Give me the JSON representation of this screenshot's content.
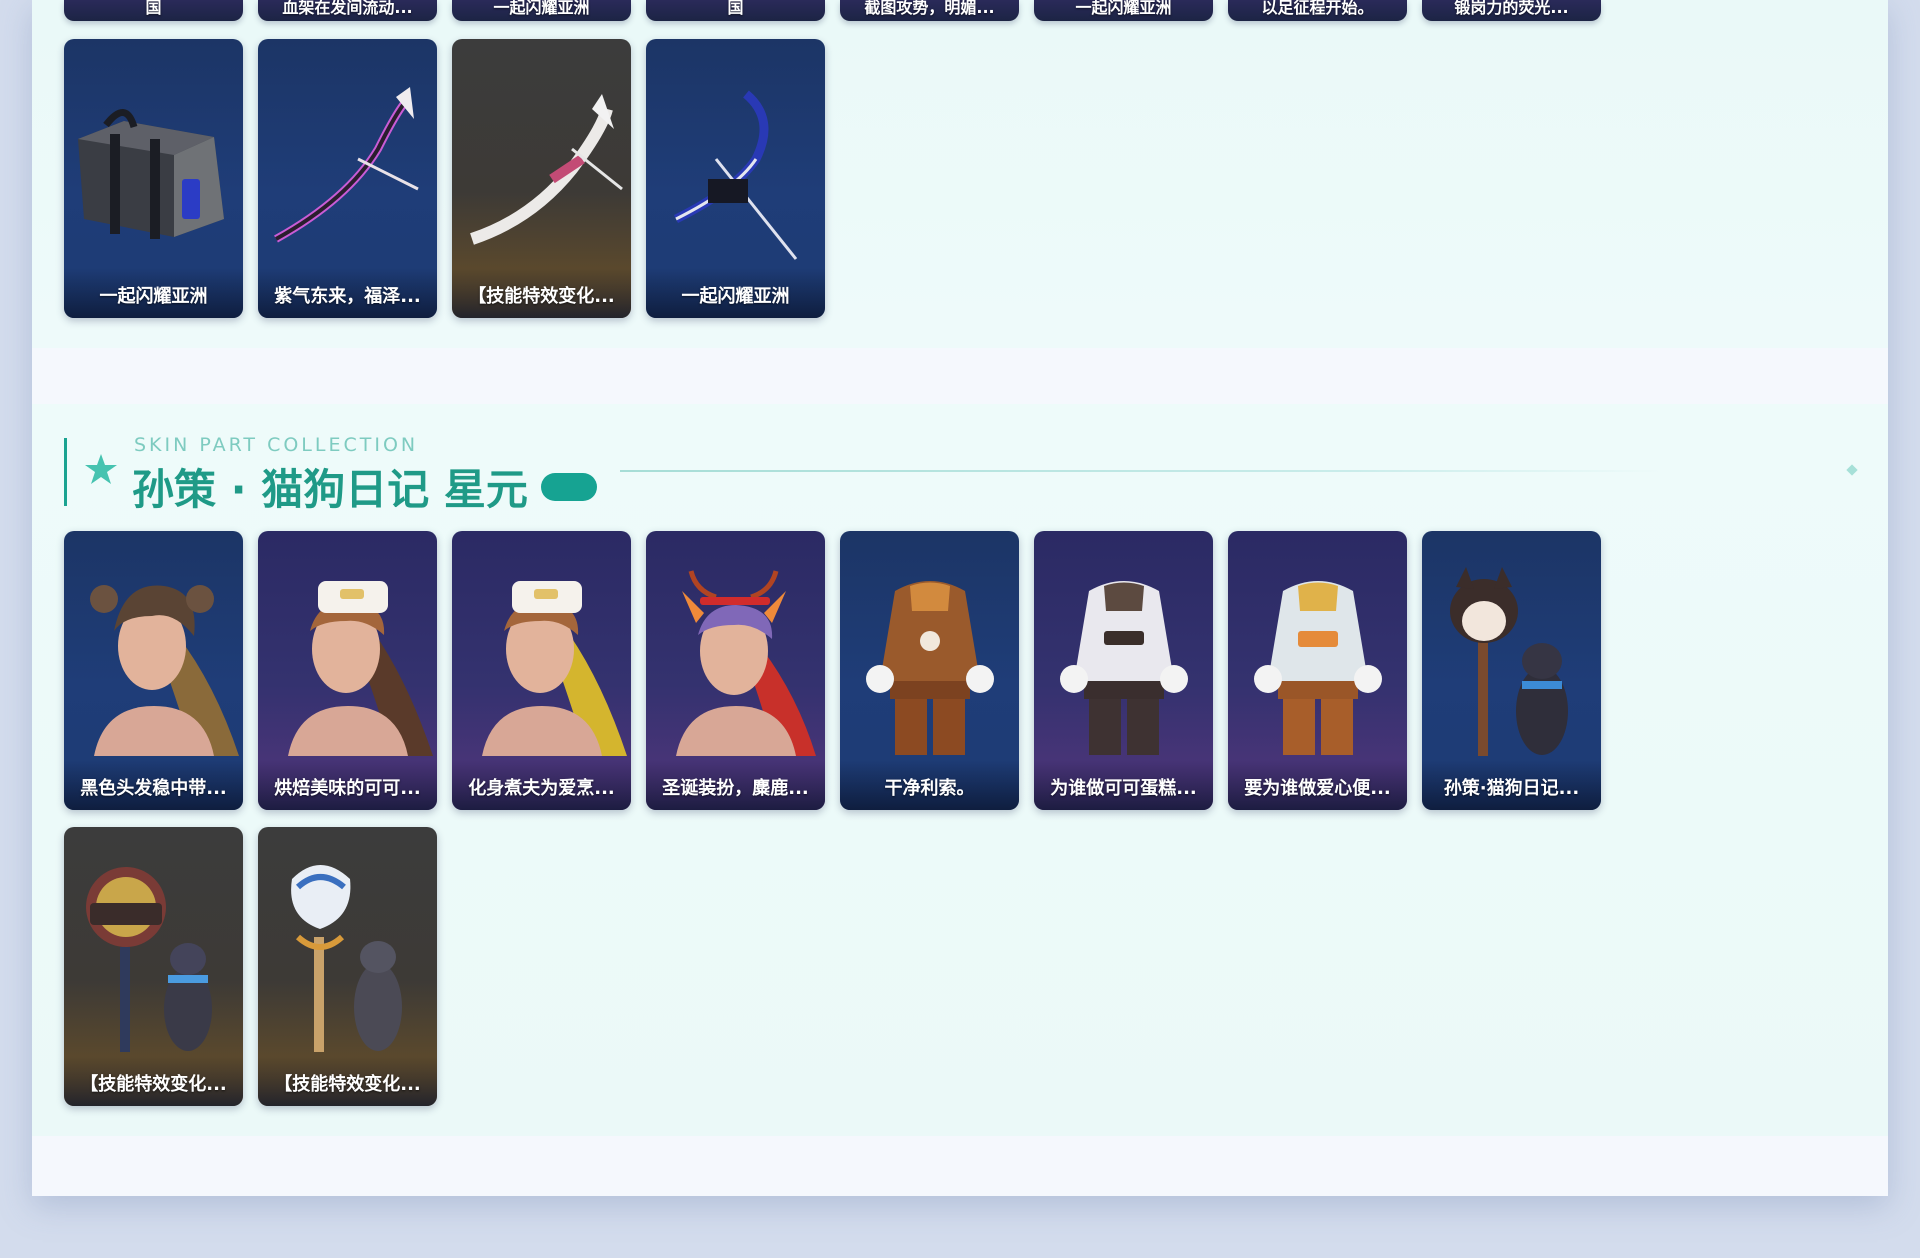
{
  "top_row": [
    {
      "label": "国"
    },
    {
      "label": "血架在发间流动..."
    },
    {
      "label": "一起闪耀亚洲"
    },
    {
      "label": "国"
    },
    {
      "label": "截图攻势，明媚..."
    },
    {
      "label": "一起闪耀亚洲"
    },
    {
      "label": "以足征程开始。"
    },
    {
      "label": "锻岗力的荧光..."
    }
  ],
  "weapon_section": {
    "cards": [
      {
        "label": "一起闪耀亚洲",
        "theme": "blue",
        "icon": "weapon-case-icon"
      },
      {
        "label": "紫气东来，福泽...",
        "theme": "blue",
        "icon": "bow-icon"
      },
      {
        "label": "【技能特效变化...",
        "theme": "gold",
        "icon": "bow-icon"
      },
      {
        "label": "一起闪耀亚洲",
        "theme": "blue",
        "icon": "bow-icon"
      }
    ]
  },
  "skin_section": {
    "subtitle": "SKIN PART COLLECTION",
    "title": "孙策 · 猫狗日记 星元",
    "accent_color": "#1aa391",
    "cards": [
      {
        "label": "黑色头发稳中带...",
        "theme": "blue",
        "icon": "hero-head-icon"
      },
      {
        "label": "烘焙美味的可可...",
        "theme": "purple",
        "icon": "hero-head-icon"
      },
      {
        "label": "化身煮夫为爱烹...",
        "theme": "purple",
        "icon": "hero-head-icon"
      },
      {
        "label": "圣诞装扮，麋鹿...",
        "theme": "purple",
        "icon": "hero-head-icon"
      },
      {
        "label": "干净利索。",
        "theme": "blue",
        "icon": "outfit-icon"
      },
      {
        "label": "为谁做可可蛋糕...",
        "theme": "purple",
        "icon": "outfit-icon"
      },
      {
        "label": "要为谁做爱心便...",
        "theme": "purple",
        "icon": "outfit-icon"
      },
      {
        "label": "孙策·猫狗日记...",
        "theme": "blue",
        "icon": "dog-staff-icon"
      },
      {
        "label": "【技能特效变化...",
        "theme": "gold",
        "icon": "dog-staff-icon"
      },
      {
        "label": "【技能特效变化...",
        "theme": "gold",
        "icon": "dog-staff-icon"
      }
    ]
  }
}
